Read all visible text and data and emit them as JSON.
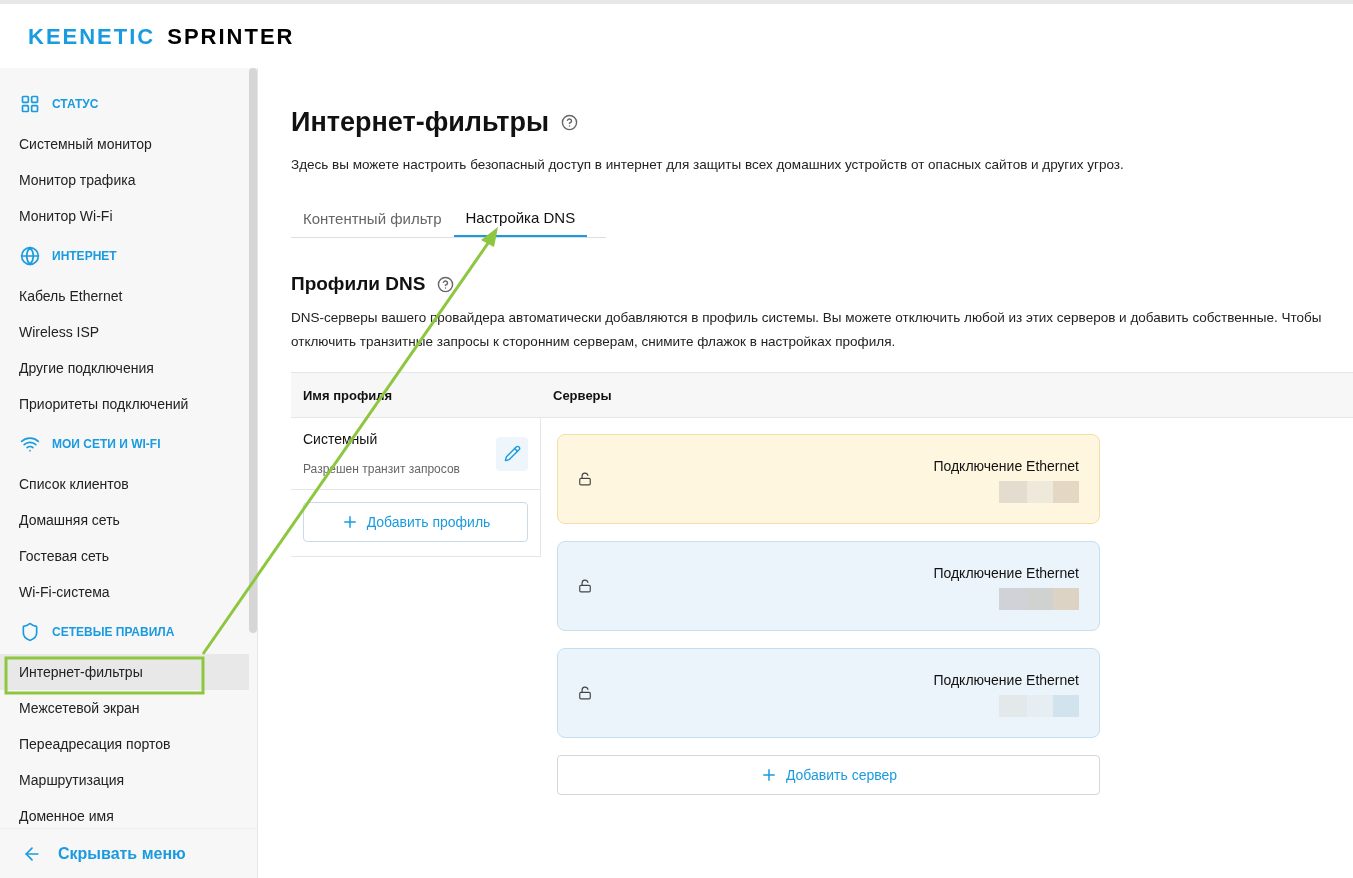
{
  "logo": {
    "brand": "KEENETIC",
    "model": "SPRINTER"
  },
  "sidebar": {
    "sections": [
      {
        "title": "СТАТУС",
        "items": [
          {
            "label": "Системный монитор",
            "selected": false
          },
          {
            "label": "Монитор трафика",
            "selected": false
          },
          {
            "label": "Монитор Wi-Fi",
            "selected": false
          }
        ]
      },
      {
        "title": "ИНТЕРНЕТ",
        "items": [
          {
            "label": "Кабель Ethernet",
            "selected": false
          },
          {
            "label": "Wireless ISP",
            "selected": false
          },
          {
            "label": "Другие подключения",
            "selected": false
          },
          {
            "label": "Приоритеты подключений",
            "selected": false
          }
        ]
      },
      {
        "title": "МОИ СЕТИ И WI-FI",
        "items": [
          {
            "label": "Список клиентов",
            "selected": false
          },
          {
            "label": "Домашняя сеть",
            "selected": false
          },
          {
            "label": "Гостевая сеть",
            "selected": false
          },
          {
            "label": "Wi-Fi-система",
            "selected": false
          }
        ]
      },
      {
        "title": "СЕТЕВЫЕ ПРАВИЛА",
        "items": [
          {
            "label": "Интернет-фильтры",
            "selected": true
          },
          {
            "label": "Межсетевой экран",
            "selected": false
          },
          {
            "label": "Переадресация портов",
            "selected": false
          },
          {
            "label": "Маршрутизация",
            "selected": false
          },
          {
            "label": "Доменное имя",
            "selected": false
          }
        ]
      }
    ],
    "footer": "Скрывать меню"
  },
  "page": {
    "title": "Интернет-фильтры",
    "description": "Здесь вы можете настроить безопасный доступ в интернет для защиты всех домашних устройств от опасных сайтов и других угроз."
  },
  "tabs": [
    {
      "label": "Контентный фильтр",
      "selected": false
    },
    {
      "label": "Настройка DNS",
      "selected": true
    }
  ],
  "section": {
    "title": "Профили DNS",
    "description": "DNS-серверы вашего провайдера автоматически добавляются в профиль системы. Вы можете отключить любой из этих серверов и добавить собственные. Чтобы отключить транзитные запросы к сторонним серверам, снимите флажок в настройках профиля."
  },
  "table": {
    "columns": [
      "Имя профиля",
      "Серверы"
    ],
    "profile": {
      "name": "Системный",
      "note": "Разрешен транзит запросов"
    },
    "add_profile": "Добавить профиль",
    "servers": [
      {
        "name": "Подключение Ethernet",
        "highlighted": true
      },
      {
        "name": "Подключение Ethernet",
        "highlighted": false
      },
      {
        "name": "Подключение Ethernet",
        "highlighted": false
      }
    ],
    "add_server": "Добавить сервер"
  }
}
